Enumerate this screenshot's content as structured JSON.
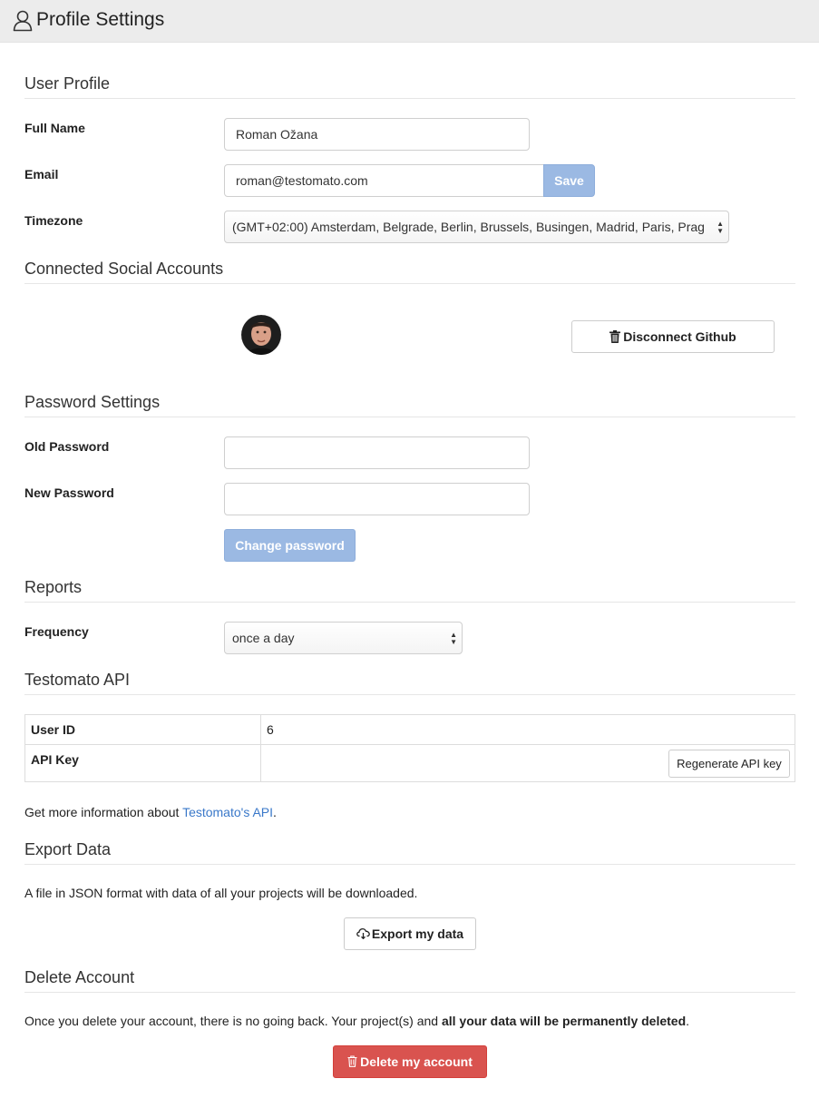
{
  "header": {
    "title": "Profile Settings",
    "icon": "user-icon"
  },
  "user_profile": {
    "section_title": "User Profile",
    "full_name_label": "Full Name",
    "full_name_value": "Roman Ožana",
    "email_label": "Email",
    "email_value": "roman@testomato.com",
    "save_label": "Save",
    "timezone_label": "Timezone",
    "timezone_value": "(GMT+02:00) Amsterdam, Belgrade, Berlin, Brussels, Busingen, Madrid, Paris, Prag"
  },
  "social": {
    "section_title": "Connected Social Accounts",
    "disconnect_label": "Disconnect Github"
  },
  "password": {
    "section_title": "Password Settings",
    "old_label": "Old Password",
    "old_value": "",
    "new_label": "New Password",
    "new_value": "",
    "change_label": "Change password"
  },
  "reports": {
    "section_title": "Reports",
    "frequency_label": "Frequency",
    "frequency_value": "once a day"
  },
  "api": {
    "section_title": "Testomato API",
    "user_id_label": "User ID",
    "user_id_value": "6",
    "api_key_label": "API Key",
    "regenerate_label": "Regenerate API key",
    "info_prefix": "Get more information about ",
    "info_link": "Testomato's API",
    "info_suffix": "."
  },
  "export": {
    "section_title": "Export Data",
    "description": "A file in JSON format with data of all your projects will be downloaded.",
    "button_label": "Export my data"
  },
  "delete": {
    "section_title": "Delete Account",
    "text_prefix": "Once you delete your account, there is no going back. Your project(s) and ",
    "text_bold": "all your data will be permanently deleted",
    "text_suffix": ".",
    "button_label": "Delete my account"
  },
  "colors": {
    "accent_blue": "#9bb9e3",
    "link_blue": "#3a78c9",
    "danger_red": "#d9534f"
  }
}
